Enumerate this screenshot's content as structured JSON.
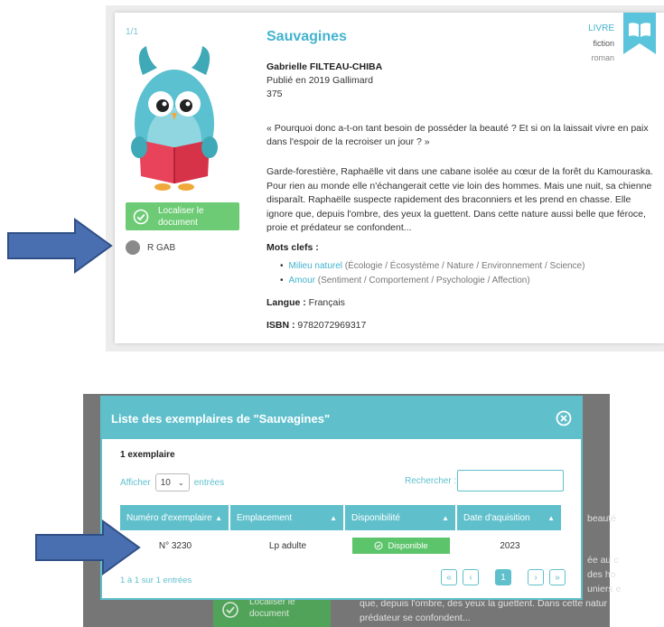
{
  "record": {
    "counter": "1/1",
    "title": "Sauvagines",
    "author": "Gabrielle FILTEAU-CHIBA",
    "published": "Publié en 2019 Gallimard",
    "pages": "375",
    "quote": "« Pourquoi donc a-t-on tant besoin de posséder la beauté ? Et si on la laissait vivre en paix dans l'espoir de la recroiser un jour ? »",
    "summary": "Garde-forestière, Raphaëlle vit dans une cabane isolée au cœur de la forêt du Kamouraska. Pour rien au monde elle n'échangerait cette vie loin des hommes. Mais une nuit, sa chienne disparaît. Raphaëlle suspecte rapidement des braconniers et les prend en chasse. Elle ignore que, depuis l'ombre, des yeux la guettent. Dans cette nature aussi belle que féroce, proie et prédateur se confondent...",
    "keywords_label": "Mots clefs :",
    "keywords": [
      {
        "link": "Milieu naturel",
        "detail": " (Écologie / Écosystème / Nature / Environnement / Science)"
      },
      {
        "link": "Amour",
        "detail": " (Sentiment / Comportement / Psychologie / Affection)"
      }
    ],
    "language_label": "Langue :",
    "language": " Français",
    "isbn_label": "ISBN :",
    "isbn": " 9782072969317",
    "type": "LIVRE",
    "genre": "fiction",
    "form": "roman",
    "locate_button": "Localiser le document",
    "call_number": "R GAB"
  },
  "background_page": {
    "line1": "beauté",
    "line2": "ée au c",
    "line3": "des ho",
    "line4": "uniers e",
    "line5": "que, depuis l'ombre, des yeux la guettent. Dans cette natur",
    "line6": "prédateur se confondent...",
    "button": "Localiser le document"
  },
  "modal": {
    "title": "Liste des exemplaires de \"Sauvagines\"",
    "count": "1 exemplaire",
    "show_prefix": "Afficher",
    "show_value": "10",
    "show_suffix": "entrées",
    "search_label": "Rechercher :",
    "columns": [
      "Numéro d'exemplaire",
      "Emplacement",
      "Disponibilité",
      "Date d'aquisition"
    ],
    "rows": [
      {
        "number": "N° 3230",
        "location": "Lp adulte",
        "availability": "Disponible",
        "date": "2023"
      }
    ],
    "info": "1 à 1 sur 1 entrées",
    "pager": {
      "first": "«",
      "prev": "‹",
      "current": "1",
      "next": "›",
      "last": "»"
    }
  },
  "colors": {
    "accent": "#42b3ce",
    "modal_teal": "#5fc0cc",
    "green": "#6ccb74",
    "arrow_blue": "#4a6fb0"
  }
}
